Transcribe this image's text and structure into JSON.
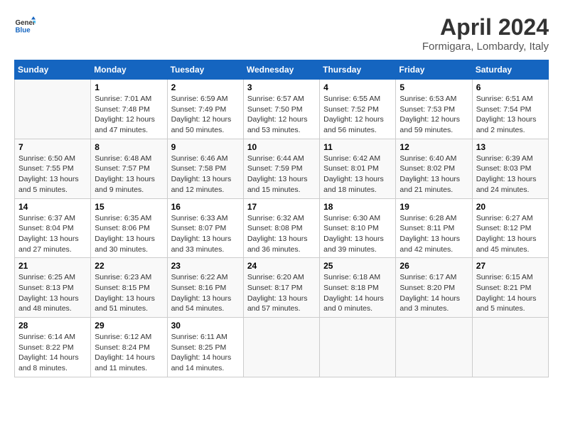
{
  "header": {
    "logo_line1": "General",
    "logo_line2": "Blue",
    "title": "April 2024",
    "subtitle": "Formigara, Lombardy, Italy"
  },
  "weekdays": [
    "Sunday",
    "Monday",
    "Tuesday",
    "Wednesday",
    "Thursday",
    "Friday",
    "Saturday"
  ],
  "weeks": [
    [
      {
        "day": "",
        "info": ""
      },
      {
        "day": "1",
        "info": "Sunrise: 7:01 AM\nSunset: 7:48 PM\nDaylight: 12 hours\nand 47 minutes."
      },
      {
        "day": "2",
        "info": "Sunrise: 6:59 AM\nSunset: 7:49 PM\nDaylight: 12 hours\nand 50 minutes."
      },
      {
        "day": "3",
        "info": "Sunrise: 6:57 AM\nSunset: 7:50 PM\nDaylight: 12 hours\nand 53 minutes."
      },
      {
        "day": "4",
        "info": "Sunrise: 6:55 AM\nSunset: 7:52 PM\nDaylight: 12 hours\nand 56 minutes."
      },
      {
        "day": "5",
        "info": "Sunrise: 6:53 AM\nSunset: 7:53 PM\nDaylight: 12 hours\nand 59 minutes."
      },
      {
        "day": "6",
        "info": "Sunrise: 6:51 AM\nSunset: 7:54 PM\nDaylight: 13 hours\nand 2 minutes."
      }
    ],
    [
      {
        "day": "7",
        "info": "Sunrise: 6:50 AM\nSunset: 7:55 PM\nDaylight: 13 hours\nand 5 minutes."
      },
      {
        "day": "8",
        "info": "Sunrise: 6:48 AM\nSunset: 7:57 PM\nDaylight: 13 hours\nand 9 minutes."
      },
      {
        "day": "9",
        "info": "Sunrise: 6:46 AM\nSunset: 7:58 PM\nDaylight: 13 hours\nand 12 minutes."
      },
      {
        "day": "10",
        "info": "Sunrise: 6:44 AM\nSunset: 7:59 PM\nDaylight: 13 hours\nand 15 minutes."
      },
      {
        "day": "11",
        "info": "Sunrise: 6:42 AM\nSunset: 8:01 PM\nDaylight: 13 hours\nand 18 minutes."
      },
      {
        "day": "12",
        "info": "Sunrise: 6:40 AM\nSunset: 8:02 PM\nDaylight: 13 hours\nand 21 minutes."
      },
      {
        "day": "13",
        "info": "Sunrise: 6:39 AM\nSunset: 8:03 PM\nDaylight: 13 hours\nand 24 minutes."
      }
    ],
    [
      {
        "day": "14",
        "info": "Sunrise: 6:37 AM\nSunset: 8:04 PM\nDaylight: 13 hours\nand 27 minutes."
      },
      {
        "day": "15",
        "info": "Sunrise: 6:35 AM\nSunset: 8:06 PM\nDaylight: 13 hours\nand 30 minutes."
      },
      {
        "day": "16",
        "info": "Sunrise: 6:33 AM\nSunset: 8:07 PM\nDaylight: 13 hours\nand 33 minutes."
      },
      {
        "day": "17",
        "info": "Sunrise: 6:32 AM\nSunset: 8:08 PM\nDaylight: 13 hours\nand 36 minutes."
      },
      {
        "day": "18",
        "info": "Sunrise: 6:30 AM\nSunset: 8:10 PM\nDaylight: 13 hours\nand 39 minutes."
      },
      {
        "day": "19",
        "info": "Sunrise: 6:28 AM\nSunset: 8:11 PM\nDaylight: 13 hours\nand 42 minutes."
      },
      {
        "day": "20",
        "info": "Sunrise: 6:27 AM\nSunset: 8:12 PM\nDaylight: 13 hours\nand 45 minutes."
      }
    ],
    [
      {
        "day": "21",
        "info": "Sunrise: 6:25 AM\nSunset: 8:13 PM\nDaylight: 13 hours\nand 48 minutes."
      },
      {
        "day": "22",
        "info": "Sunrise: 6:23 AM\nSunset: 8:15 PM\nDaylight: 13 hours\nand 51 minutes."
      },
      {
        "day": "23",
        "info": "Sunrise: 6:22 AM\nSunset: 8:16 PM\nDaylight: 13 hours\nand 54 minutes."
      },
      {
        "day": "24",
        "info": "Sunrise: 6:20 AM\nSunset: 8:17 PM\nDaylight: 13 hours\nand 57 minutes."
      },
      {
        "day": "25",
        "info": "Sunrise: 6:18 AM\nSunset: 8:18 PM\nDaylight: 14 hours\nand 0 minutes."
      },
      {
        "day": "26",
        "info": "Sunrise: 6:17 AM\nSunset: 8:20 PM\nDaylight: 14 hours\nand 3 minutes."
      },
      {
        "day": "27",
        "info": "Sunrise: 6:15 AM\nSunset: 8:21 PM\nDaylight: 14 hours\nand 5 minutes."
      }
    ],
    [
      {
        "day": "28",
        "info": "Sunrise: 6:14 AM\nSunset: 8:22 PM\nDaylight: 14 hours\nand 8 minutes."
      },
      {
        "day": "29",
        "info": "Sunrise: 6:12 AM\nSunset: 8:24 PM\nDaylight: 14 hours\nand 11 minutes."
      },
      {
        "day": "30",
        "info": "Sunrise: 6:11 AM\nSunset: 8:25 PM\nDaylight: 14 hours\nand 14 minutes."
      },
      {
        "day": "",
        "info": ""
      },
      {
        "day": "",
        "info": ""
      },
      {
        "day": "",
        "info": ""
      },
      {
        "day": "",
        "info": ""
      }
    ]
  ]
}
